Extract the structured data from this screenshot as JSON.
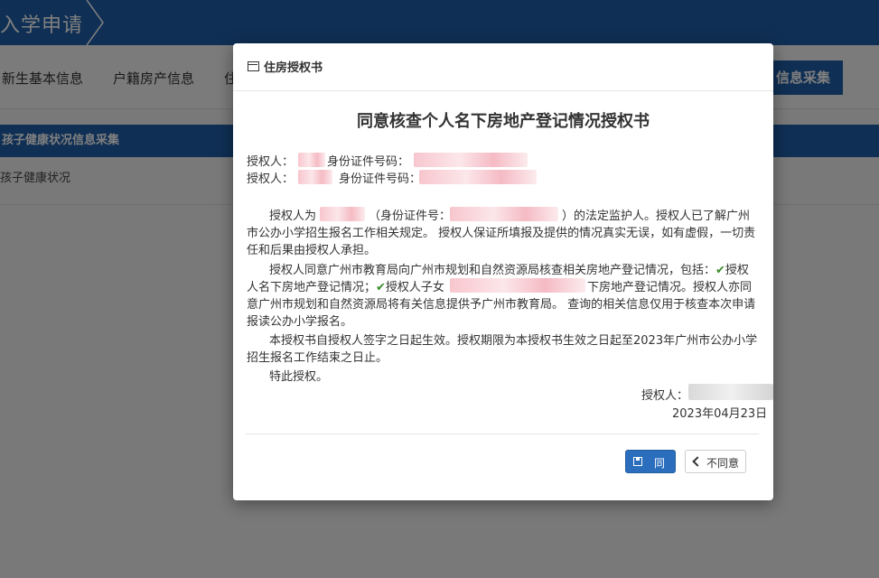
{
  "page": {
    "title": "入学申请",
    "nav": [
      "新生基本信息",
      "户籍房产信息",
      "住",
      "信息采集"
    ],
    "section_title": "孩子健康状况信息采集",
    "section_row": "孩子健康状况"
  },
  "modal": {
    "title": "住房授权书",
    "doc_title": "同意核查个人名下房地产登记情况授权书",
    "auth1_label": "授权人：",
    "auth1_id_label": "身份证件号码：",
    "auth2_label": "授权人：",
    "auth2_id_label": "身份证件号码：",
    "p1_line1_a": "授权人为",
    "p1_line1_b": "（身份证件号：",
    "p1_line1_c": "）的法定监护人。授权人已了解广州",
    "p1_line2": "市公办小学招生报名工作相关规定。 授权人保证所填报及提供的情况真实无误，如有虚假，一切责",
    "p1_line3": "任和后果由授权人承担。",
    "p2_line1_a": "授权人同意广州市教育局向广州市规划和自然资源局核查相关房地产登记情况，包括：",
    "p2_line1_b": "授权",
    "p2_line2_a": "人名下房地产登记情况；",
    "p2_line2_b": "授权人子女",
    "p2_line2_c": "下房地产登记情况。授权人亦同",
    "p2_line3": "意广州市规划和自然资源局将有关信息提供予广州市教育局。 查询的相关信息仅用于核查本次申请",
    "p2_line4": "报读公办小学报名。",
    "p3_line1": "本授权书自授权人签字之日起生效。授权期限为本授权书生效之日起至2023年广州市公办小学",
    "p3_line2": "招生报名工作结束之日止。",
    "p4": "特此授权。",
    "sign_label": "授权人：",
    "date": "2023年04月23日",
    "check_mark": "✔",
    "agree_label": "同意",
    "disagree_label": "不同意"
  },
  "colors": {
    "brand_blue": "#1f5ea8",
    "button_blue": "#2a6ebd",
    "check_green": "#3a8c2a"
  }
}
